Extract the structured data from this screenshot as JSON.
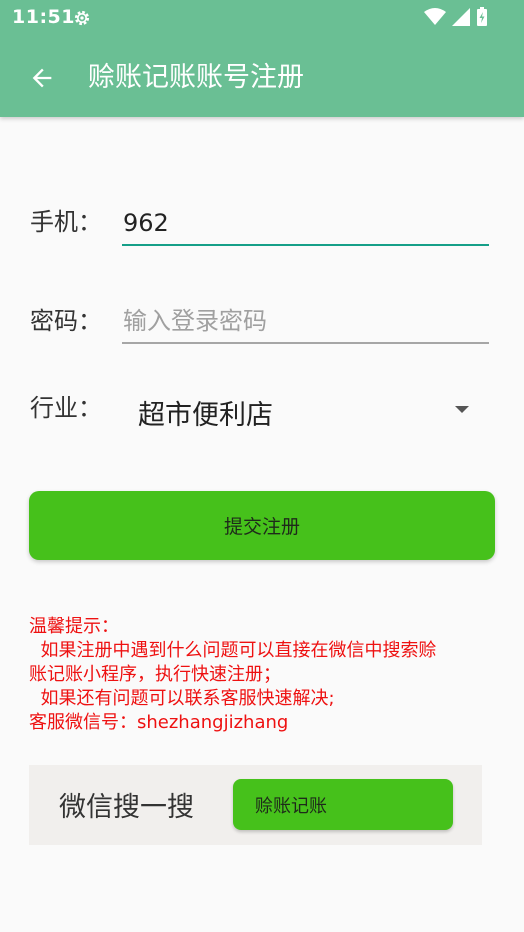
{
  "status_bar": {
    "time": "11:51"
  },
  "app_bar": {
    "title": "赊账记账账号注册"
  },
  "form": {
    "phone": {
      "label": "手机：",
      "value": "962"
    },
    "password": {
      "label": "密码：",
      "placeholder": "输入登录密码"
    },
    "industry": {
      "label": "行业：",
      "selected": "超市便利店"
    },
    "submit_label": "提交注册"
  },
  "tips": {
    "title": "温馨提示：",
    "line1": "  如果注册中遇到什么问题可以直接在微信中搜索赊",
    "line2": "账记账小程序，执行快速注册；",
    "line3": "  如果还有问题可以联系客服快速解决;",
    "line4": "客服微信号：shezhangjizhang"
  },
  "wechat_search": {
    "label": "微信搜一搜",
    "button_label": "赊账记账"
  },
  "colors": {
    "app_bar": "#6abf94",
    "accent_green": "#46c11b",
    "tips_red": "#ee1111",
    "input_focus": "#159f88"
  }
}
